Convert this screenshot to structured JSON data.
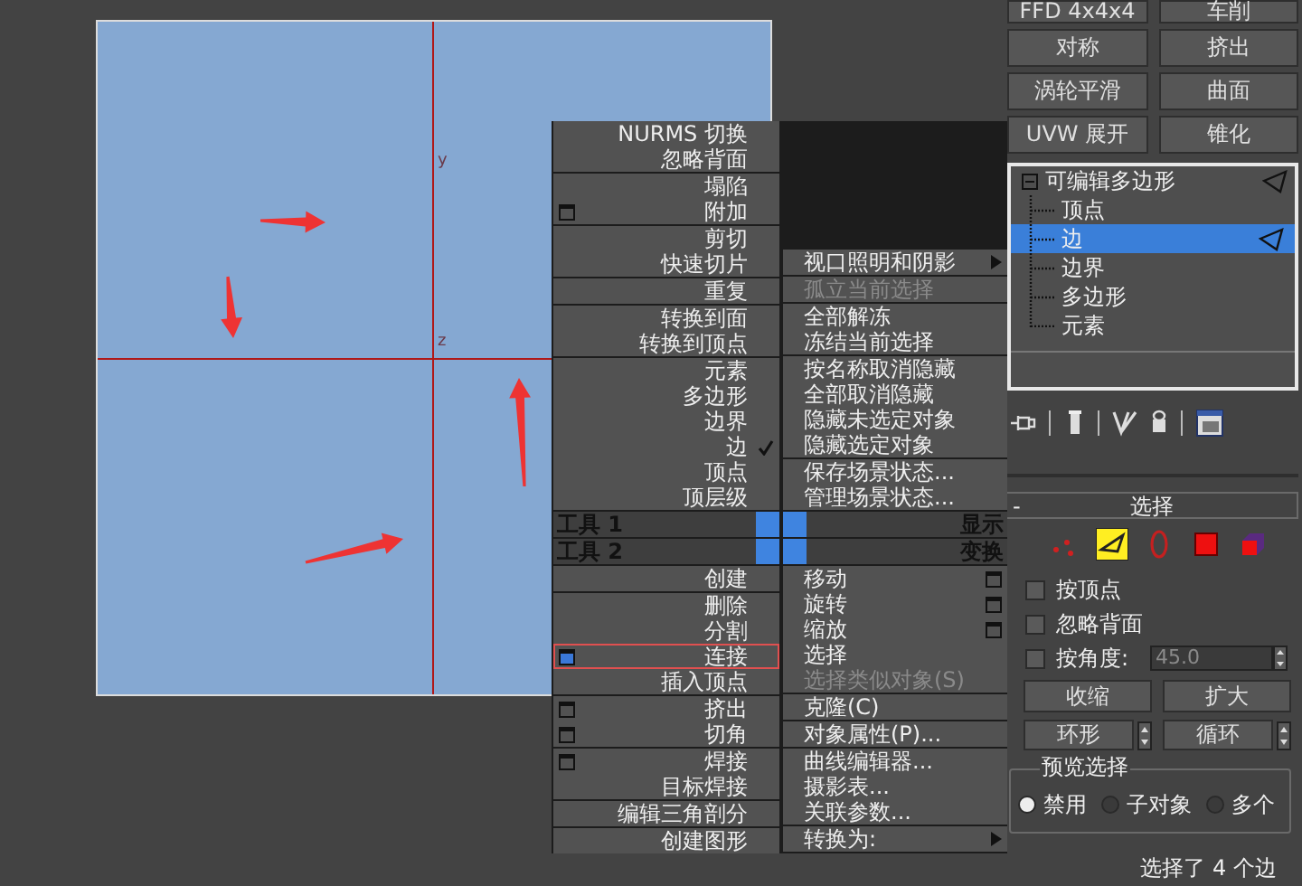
{
  "viewport": {
    "axis_labels": [
      "y",
      "z"
    ]
  },
  "quad_menu": {
    "top_left": [
      [
        {
          "label": "NURMS 切换",
          "options": false,
          "checked": false
        },
        {
          "label": "忽略背面",
          "options": false,
          "checked": false
        }
      ],
      [
        {
          "label": "塌陷",
          "options": false,
          "checked": false
        },
        {
          "label": "附加",
          "options": true,
          "checked": false
        }
      ],
      [
        {
          "label": "剪切",
          "options": false,
          "checked": false
        },
        {
          "label": "快速切片",
          "options": false,
          "checked": false
        }
      ],
      [
        {
          "label": "重复",
          "options": false,
          "checked": false
        }
      ],
      [
        {
          "label": "转换到面",
          "options": false,
          "checked": false
        },
        {
          "label": "转换到顶点",
          "options": false,
          "checked": false
        }
      ],
      [
        {
          "label": "元素",
          "options": false,
          "checked": false
        },
        {
          "label": "多边形",
          "options": false,
          "checked": false
        },
        {
          "label": "边界",
          "options": false,
          "checked": false
        },
        {
          "label": "边",
          "options": false,
          "checked": true
        },
        {
          "label": "顶点",
          "options": false,
          "checked": false
        },
        {
          "label": "顶层级",
          "options": false,
          "checked": false
        }
      ]
    ],
    "top_right": [
      [
        {
          "label": "视口照明和阴影",
          "disabled": false,
          "submenu": true
        }
      ],
      [
        {
          "label": "孤立当前选择",
          "disabled": true,
          "submenu": false
        }
      ],
      [
        {
          "label": "全部解冻",
          "disabled": false,
          "submenu": false
        },
        {
          "label": "冻结当前选择",
          "disabled": false,
          "submenu": false
        }
      ],
      [
        {
          "label": "按名称取消隐藏",
          "disabled": false,
          "submenu": false
        },
        {
          "label": "全部取消隐藏",
          "disabled": false,
          "submenu": false
        },
        {
          "label": "隐藏未选定对象",
          "disabled": false,
          "submenu": false
        },
        {
          "label": "隐藏选定对象",
          "disabled": false,
          "submenu": false
        }
      ],
      [
        {
          "label": "保存场景状态...",
          "disabled": false,
          "submenu": false
        },
        {
          "label": "管理场景状态...",
          "disabled": false,
          "submenu": false
        }
      ]
    ],
    "titles": [
      {
        "left": "工具 1",
        "right": "显示"
      },
      {
        "left": "工具 2",
        "right": "变换"
      }
    ],
    "bottom_left": [
      [
        {
          "label": "创建",
          "options": false,
          "selected": false
        }
      ],
      [
        {
          "label": "删除",
          "options": false,
          "selected": false
        },
        {
          "label": "分割",
          "options": false,
          "selected": false
        },
        {
          "label": "连接",
          "options": true,
          "selected": true
        },
        {
          "label": "插入顶点",
          "options": false,
          "selected": false
        }
      ],
      [
        {
          "label": "挤出",
          "options": true,
          "selected": false
        },
        {
          "label": "切角",
          "options": true,
          "selected": false
        }
      ],
      [
        {
          "label": "焊接",
          "options": true,
          "selected": false
        },
        {
          "label": "目标焊接",
          "options": false,
          "selected": false
        }
      ],
      [
        {
          "label": "编辑三角剖分",
          "options": false,
          "selected": false
        }
      ],
      [
        {
          "label": "创建图形",
          "options": false,
          "selected": false
        }
      ]
    ],
    "bottom_right": [
      [
        {
          "label": "移动",
          "options": true,
          "disabled": false,
          "submenu": false
        },
        {
          "label": "旋转",
          "options": true,
          "disabled": false,
          "submenu": false
        },
        {
          "label": "缩放",
          "options": true,
          "disabled": false,
          "submenu": false
        },
        {
          "label": "选择",
          "options": false,
          "disabled": false,
          "submenu": false
        },
        {
          "label": "选择类似对象(S)",
          "options": false,
          "disabled": true,
          "submenu": false
        }
      ],
      [
        {
          "label": "克隆(C)",
          "options": false,
          "disabled": false,
          "submenu": false
        }
      ],
      [
        {
          "label": "对象属性(P)...",
          "options": false,
          "disabled": false,
          "submenu": false
        }
      ],
      [
        {
          "label": "曲线编辑器...",
          "options": false,
          "disabled": false,
          "submenu": false
        },
        {
          "label": "摄影表...",
          "options": false,
          "disabled": false,
          "submenu": false
        },
        {
          "label": "关联参数...",
          "options": false,
          "disabled": false,
          "submenu": false
        }
      ],
      [
        {
          "label": "转换为:",
          "options": false,
          "disabled": false,
          "submenu": true
        }
      ]
    ]
  },
  "modifier_buttons": [
    "FFD 4x4x4",
    "车削",
    "对称",
    "挤出",
    "涡轮平滑",
    "曲面",
    "UVW 展开",
    "锥化"
  ],
  "modifier_stack": {
    "title": "可编辑多边形",
    "expanded": true,
    "children": [
      {
        "label": "顶点",
        "selected": false
      },
      {
        "label": "边",
        "selected": true
      },
      {
        "label": "边界",
        "selected": false
      },
      {
        "label": "多边形",
        "selected": false
      },
      {
        "label": "元素",
        "selected": false
      }
    ]
  },
  "selection_rollout": {
    "collapse": "-",
    "title": "选择",
    "levels": [
      {
        "kind": "vertex",
        "selected": false
      },
      {
        "kind": "edge",
        "selected": true
      },
      {
        "kind": "border",
        "selected": false
      },
      {
        "kind": "polygon",
        "selected": false
      },
      {
        "kind": "element",
        "selected": false
      }
    ],
    "checkboxes": [
      {
        "label": "按顶点",
        "checked": false
      },
      {
        "label": "忽略背面",
        "checked": false
      },
      {
        "label": "按角度:",
        "checked": false
      }
    ],
    "angle_value": "45.0",
    "buttons": [
      "收缩",
      "扩大"
    ],
    "spinner_buttons": [
      "环形",
      "循环"
    ],
    "preview": {
      "title": "预览选择",
      "options": [
        {
          "label": "禁用",
          "selected": true
        },
        {
          "label": "子对象",
          "selected": false
        },
        {
          "label": "多个",
          "selected": false
        }
      ]
    },
    "status": "选择了 4 个边"
  }
}
